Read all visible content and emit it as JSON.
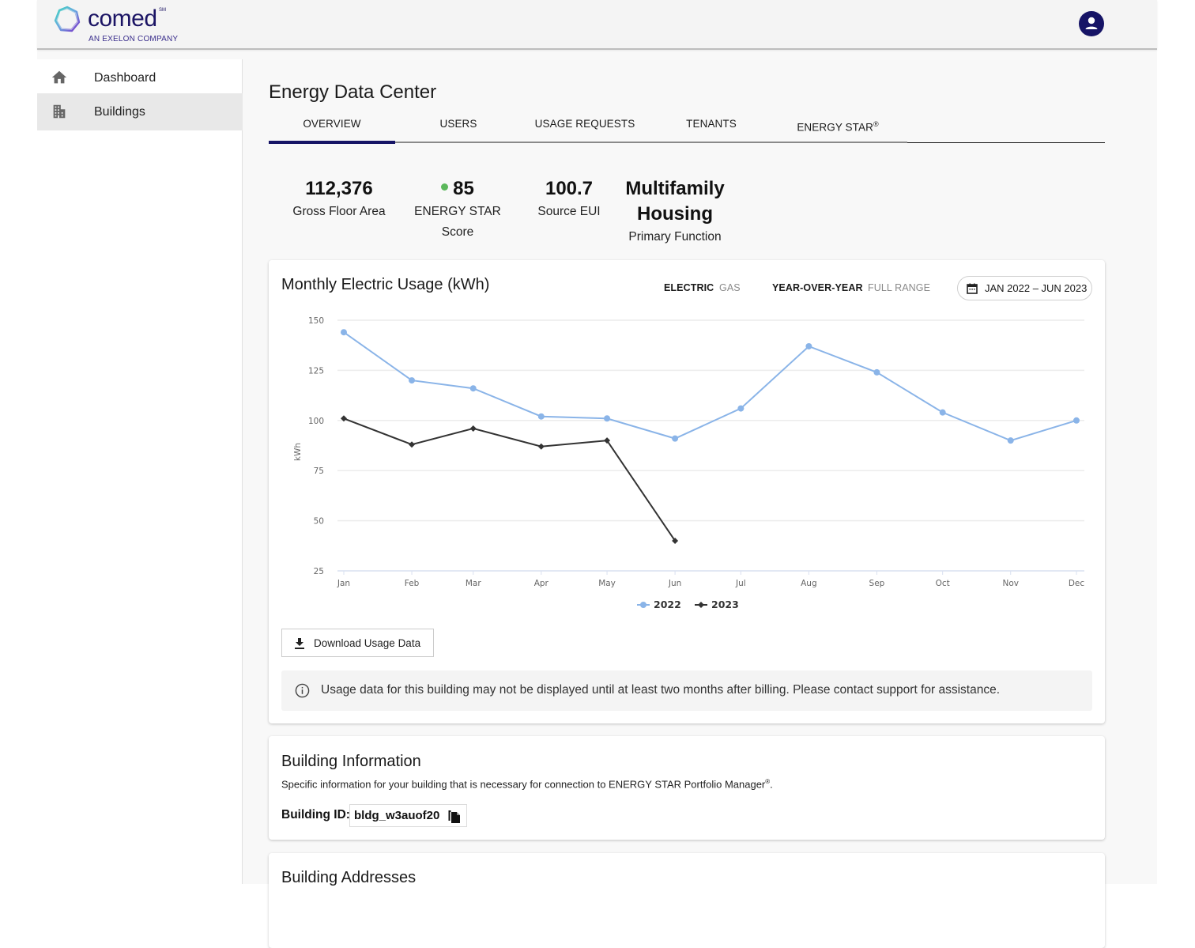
{
  "brand": {
    "name": "comed",
    "trademark": "SM",
    "tagline": "AN EXELON COMPANY",
    "colors": {
      "navy": "#161466",
      "series_2022": "#8ab4e8",
      "series_2023": "#333333",
      "score_dot": "#5cb85c"
    }
  },
  "header": {
    "avatar_icon": "account-circle-icon"
  },
  "sidebar": {
    "items": [
      {
        "label": "Dashboard",
        "icon": "home-icon",
        "active": false
      },
      {
        "label": "Buildings",
        "icon": "building-icon",
        "active": true
      }
    ]
  },
  "page": {
    "title": "Energy Data Center",
    "tabs": [
      {
        "label": "OVERVIEW",
        "active": true
      },
      {
        "label": "USERS",
        "active": false
      },
      {
        "label": "USAGE REQUESTS",
        "active": false
      },
      {
        "label": "TENANTS",
        "active": false
      },
      {
        "label": "ENERGY STAR",
        "sup": "®",
        "active": false
      }
    ]
  },
  "stats": [
    {
      "value": "112,376",
      "label": "Gross Floor Area"
    },
    {
      "value": "85",
      "label": "ENERGY STAR Score",
      "indicator": "green-dot"
    },
    {
      "value": "100.7",
      "label": "Source EUI"
    },
    {
      "value_line1": "Multifamily",
      "value_line2": "Housing",
      "label": "Primary Function"
    }
  ],
  "usage_card": {
    "title": "Monthly Electric Usage (kWh)",
    "fuel_toggle": {
      "options": [
        "ELECTRIC",
        "GAS"
      ],
      "selected": "ELECTRIC"
    },
    "range_toggle": {
      "options": [
        "YEAR-OVER-YEAR",
        "FULL RANGE"
      ],
      "selected": "YEAR-OVER-YEAR"
    },
    "date_range": "JAN 2022 – JUN 2023",
    "download_label": "Download Usage Data",
    "notice": "Usage data for this building may not be displayed until at least two months after billing. Please contact support for assistance."
  },
  "chart_data": {
    "type": "line",
    "title": "Monthly Electric Usage (kWh)",
    "xlabel": "",
    "ylabel": "kWh",
    "categories": [
      "Jan",
      "Feb",
      "Mar",
      "Apr",
      "May",
      "Jun",
      "Jul",
      "Aug",
      "Sep",
      "Oct",
      "Nov",
      "Dec"
    ],
    "ylim": [
      25,
      150
    ],
    "yticks": [
      25,
      50,
      75,
      100,
      125,
      150
    ],
    "grid": true,
    "legend": "bottom-center",
    "series": [
      {
        "name": "2022",
        "color": "#8ab4e8",
        "marker": "circle",
        "values": [
          144,
          120,
          116,
          102,
          101,
          91,
          106,
          137,
          124,
          104,
          90,
          100
        ]
      },
      {
        "name": "2023",
        "color": "#333333",
        "marker": "diamond",
        "values": [
          101,
          88,
          96,
          87,
          90,
          40
        ]
      }
    ]
  },
  "building_info": {
    "title": "Building Information",
    "description": "Specific information for your building that is necessary for connection to ENERGY STAR Portfolio Manager",
    "description_sup": "®",
    "description_end": ".",
    "id_label": "Building ID:",
    "id_value": "bldg_w3auof20"
  },
  "building_addresses": {
    "title": "Building Addresses"
  }
}
